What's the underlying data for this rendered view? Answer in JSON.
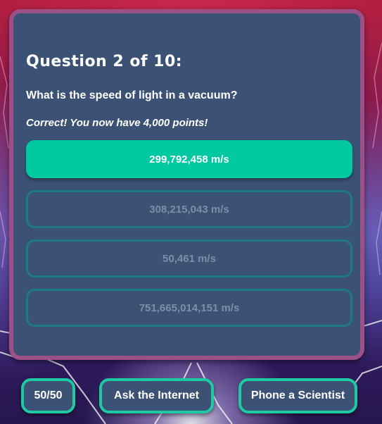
{
  "question": {
    "title": "Question 2 of 10:",
    "text": "What is the speed of light in a vacuum?",
    "feedback": "Correct! You now have 4,000 points!"
  },
  "answers": [
    {
      "label": "299,792,458 m/s",
      "state": "correct"
    },
    {
      "label": "308,215,043 m/s",
      "state": "disabled"
    },
    {
      "label": "50,461 m/s",
      "state": "disabled"
    },
    {
      "label": "751,665,014,151 m/s",
      "state": "disabled"
    }
  ],
  "lifelines": {
    "fifty_fifty": "50/50",
    "ask_internet": "Ask the Internet",
    "phone_scientist": "Phone a Scientist"
  },
  "colors": {
    "panel_bg": "#3c5274",
    "panel_border": "#9c5088",
    "correct_bg": "#00c8a0",
    "disabled_border": "#1c7a80",
    "lifeline_border": "#1ec9a5"
  }
}
